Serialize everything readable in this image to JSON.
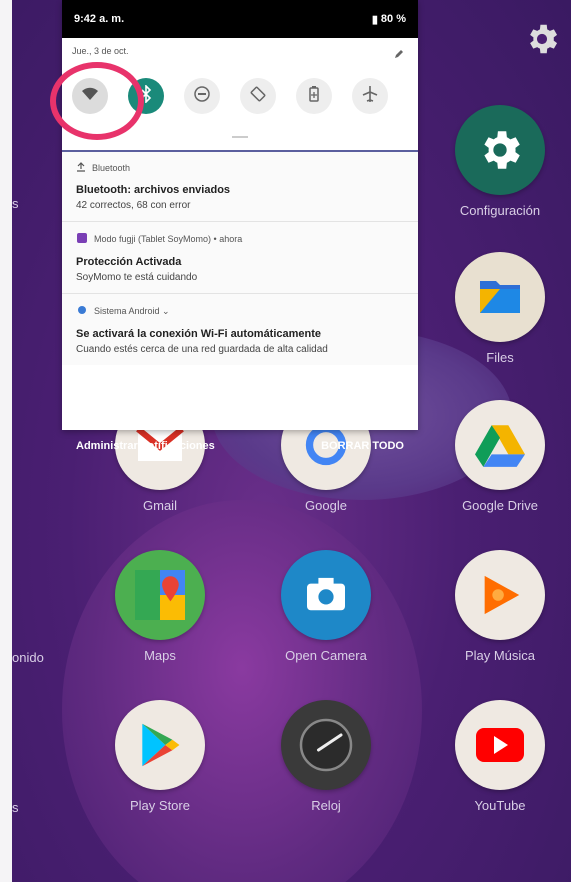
{
  "status_bar": {
    "time": "9:42 a. m.",
    "battery": "80 %"
  },
  "quick_settings": {
    "date": "Jue., 3 de oct.",
    "tiles": [
      {
        "name": "wifi-icon",
        "state": "off"
      },
      {
        "name": "bluetooth-icon",
        "state": "on"
      },
      {
        "name": "do-not-disturb-icon",
        "state": "off"
      },
      {
        "name": "auto-rotate-icon",
        "state": "off"
      },
      {
        "name": "battery-saver-icon",
        "state": "off"
      },
      {
        "name": "airplane-icon",
        "state": "off"
      }
    ]
  },
  "notifications": [
    {
      "app": "Bluetooth",
      "title": "Bluetooth: archivos enviados",
      "body": "42 correctos, 68 con error"
    },
    {
      "app": "Modo fugji (Tablet SoyMomo) • ahora",
      "title": "Protección Activada",
      "body": "SoyMomo te está cuidando"
    },
    {
      "app": "Sistema Android ⌄",
      "title": "Se activará la conexión Wi-Fi automáticamente",
      "body": "Cuando estés cerca de una red guardada de alta calidad"
    }
  ],
  "footer": {
    "manage": "Administrar notificaciones",
    "clear": "BORRAR TODO"
  },
  "home_apps": {
    "configuracion": "Configuración",
    "files": "Files",
    "gmail": "Gmail",
    "google": "Google",
    "google_drive": "Google Drive",
    "maps": "Maps",
    "open_camera": "Open Camera",
    "play_musica": "Play Música",
    "play_store": "Play Store",
    "reloj": "Reloj",
    "youtube": "YouTube",
    "edge_left_1": "s",
    "edge_left_2": "onido",
    "edge_left_3": "s"
  },
  "colors": {
    "highlight_ring": "#e8336b",
    "bluetooth_on": "#1a8a7a",
    "wallpaper": "#4a1f72"
  }
}
